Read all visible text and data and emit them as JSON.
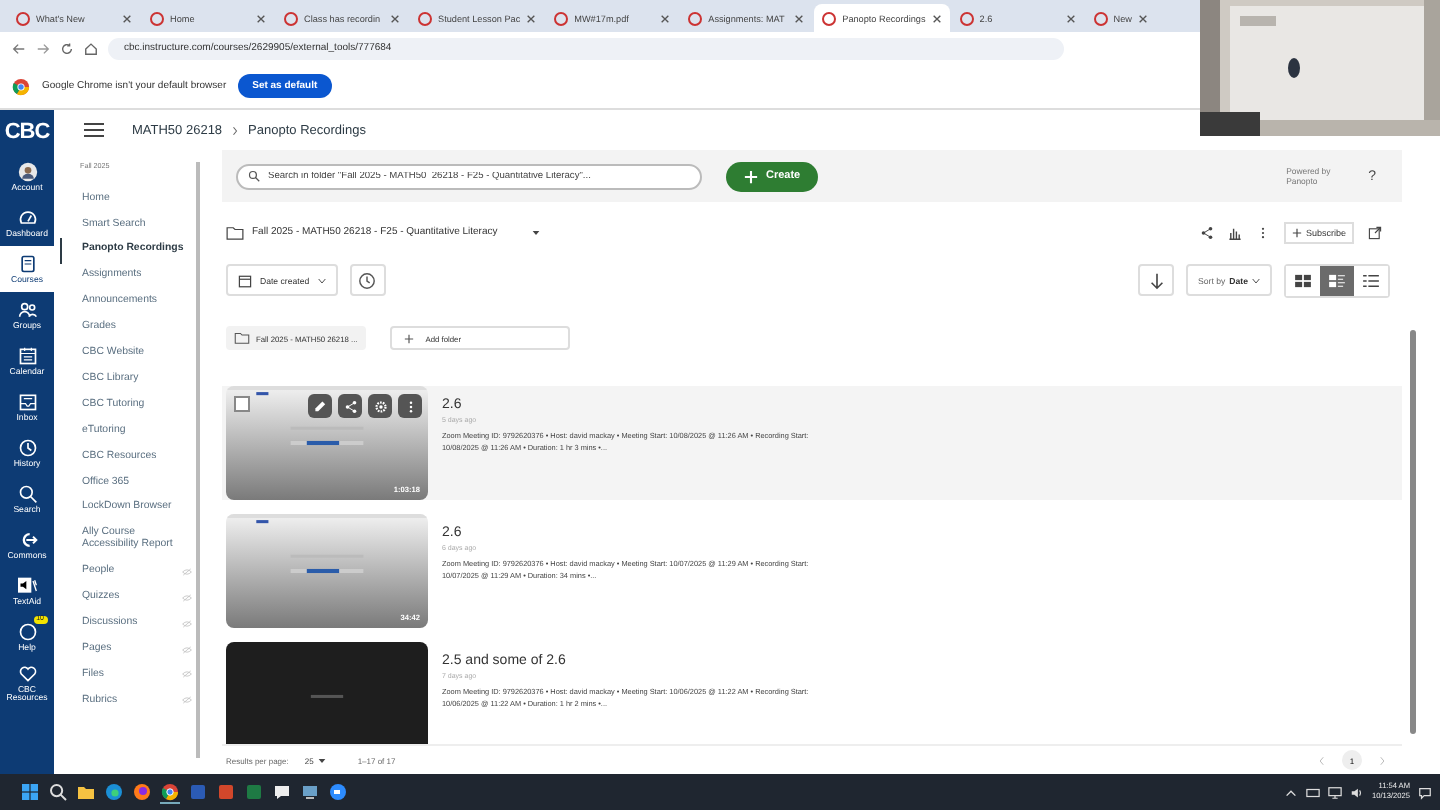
{
  "browser": {
    "tabs": [
      {
        "label": "What's New",
        "selected": false
      },
      {
        "label": "Home",
        "selected": false
      },
      {
        "label": "Class has recordin",
        "selected": false
      },
      {
        "label": "Student Lesson Pac",
        "selected": false
      },
      {
        "label": "MW#17m.pdf",
        "selected": false
      },
      {
        "label": "Assignments: MAT",
        "selected": false
      },
      {
        "label": "Panopto Recordings",
        "selected": true
      },
      {
        "label": "2.6",
        "selected": false
      },
      {
        "label": "New",
        "selected": false
      }
    ],
    "url": "cbc.instructure.com/courses/2629905/external_tools/777684",
    "banner": {
      "text": "Google Chrome isn't your default browser",
      "button": "Set as default"
    }
  },
  "global_nav": {
    "logo": "CBC",
    "items": [
      {
        "label": "Account",
        "selected": false
      },
      {
        "label": "Dashboard",
        "selected": false
      },
      {
        "label": "Courses",
        "selected": true
      },
      {
        "label": "Groups",
        "selected": false
      },
      {
        "label": "Calendar",
        "selected": false
      },
      {
        "label": "Inbox",
        "selected": false
      },
      {
        "label": "History",
        "selected": false
      },
      {
        "label": "Search",
        "selected": false
      },
      {
        "label": "Commons",
        "selected": false
      },
      {
        "label": "TextAid",
        "selected": false
      },
      {
        "label": "Help",
        "selected": false,
        "badge": "10"
      },
      {
        "label": "CBC Resources",
        "selected": false
      }
    ]
  },
  "breadcrumb": {
    "course": "MATH50 26218",
    "page": "Panopto Recordings"
  },
  "course_nav": {
    "term": "Fall 2025",
    "items": [
      {
        "label": "Home",
        "selected": false,
        "hidden": false
      },
      {
        "label": "Smart Search",
        "selected": false,
        "hidden": false
      },
      {
        "label": "Panopto Recordings",
        "selected": true,
        "hidden": false
      },
      {
        "label": "Assignments",
        "selected": false,
        "hidden": false
      },
      {
        "label": "Announcements",
        "selected": false,
        "hidden": false
      },
      {
        "label": "Grades",
        "selected": false,
        "hidden": false
      },
      {
        "label": "CBC Website",
        "selected": false,
        "hidden": false
      },
      {
        "label": "CBC Library",
        "selected": false,
        "hidden": false
      },
      {
        "label": "CBC Tutoring",
        "selected": false,
        "hidden": false
      },
      {
        "label": "eTutoring",
        "selected": false,
        "hidden": false
      },
      {
        "label": "CBC Resources",
        "selected": false,
        "hidden": false
      },
      {
        "label": "Office 365",
        "selected": false,
        "hidden": false
      },
      {
        "label": "LockDown Browser",
        "selected": false,
        "hidden": false
      },
      {
        "label": "Ally Course Accessibility Report",
        "selected": false,
        "hidden": false
      },
      {
        "label": "People",
        "selected": false,
        "hidden": true
      },
      {
        "label": "Quizzes",
        "selected": false,
        "hidden": true
      },
      {
        "label": "Discussions",
        "selected": false,
        "hidden": true
      },
      {
        "label": "Pages",
        "selected": false,
        "hidden": true
      },
      {
        "label": "Files",
        "selected": false,
        "hidden": true
      },
      {
        "label": "Rubrics",
        "selected": false,
        "hidden": true
      }
    ]
  },
  "panopto": {
    "search": {
      "placeholder": "Search in folder \"Fall 2025 - MATH50  26218 - F25 - Quantitative Literacy\"..."
    },
    "create": "Create",
    "powered_by": "Powered by Panopto",
    "help": "?",
    "folder": "Fall 2025 - MATH50  26218 - F25 - Quantitative Literacy",
    "subscribe": "Subscribe",
    "date_filter": "Date created",
    "sort": {
      "prefix": "Sort by",
      "value": "Date"
    },
    "views": [
      {
        "kind": "thumbnails",
        "selected": false
      },
      {
        "kind": "details",
        "selected": true
      },
      {
        "kind": "list",
        "selected": false
      }
    ],
    "subfolder": "Fall 2025 - MATH50 26218 ...",
    "add_folder": "Add folder",
    "sessions": [
      {
        "title": "2.6",
        "age": "5 days ago",
        "highlighted": true,
        "duration": "1:03:18",
        "meta": "Zoom Meeting ID: 9792620376  • Host: david mackay  • Meeting Start: 10/08/2025 @ 11:26 AM  • Recording Start: 10/08/2025 @ 11:26 AM  • Duration: 1 hr 3 mins  •..."
      },
      {
        "title": "2.6",
        "age": "6 days ago",
        "highlighted": false,
        "duration": "34:42",
        "meta": "Zoom Meeting ID: 9792620376  • Host: david mackay  • Meeting Start: 10/07/2025 @ 11:29 AM  • Recording Start: 10/07/2025 @ 11:29 AM  • Duration: 34 mins  •..."
      },
      {
        "title": "2.5 and some of 2.6",
        "age": "7 days ago",
        "highlighted": false,
        "meta": "Zoom Meeting ID: 9792620376  • Host: david mackay  • Meeting Start: 10/06/2025 @ 11:22 AM  • Recording Start: 10/06/2025 @ 11:22 AM  • Duration: 1 hr 2 mins  •..."
      }
    ],
    "footer": {
      "per_page_label": "Results per page:",
      "per_page": "25",
      "range": "1–17 of 17",
      "page": "1"
    }
  },
  "taskbar": {
    "time": "11:54 AM",
    "date": "10/13/2025"
  }
}
